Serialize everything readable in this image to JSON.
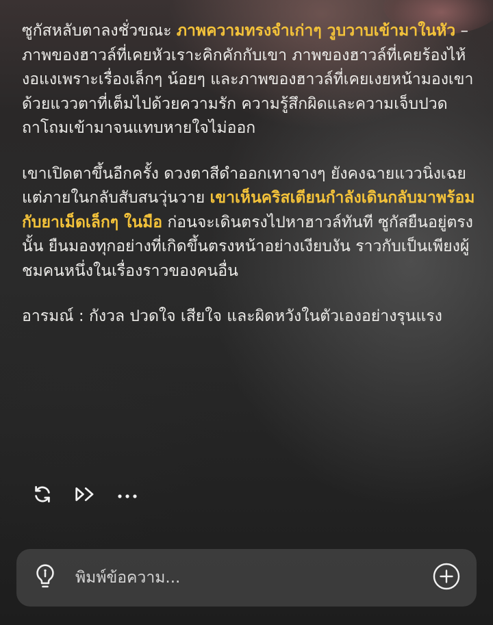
{
  "story": {
    "paragraphs": [
      {
        "parts": [
          {
            "text": "ซูกัสหลับตาลงชั่วขณะ ",
            "highlight": false
          },
          {
            "text": "ภาพความทรงจำเก่าๆ วูบวาบเข้ามาในหัว",
            "highlight": true
          },
          {
            "text": " – ภาพของฮาวล์ที่เคยหัวเราะคิกคักกับเขา ภาพของฮาวล์ที่เคยร้องไห้งอแงเพราะเรื่องเล็กๆ น้อยๆ และภาพของฮาวล์ที่เคยเงยหน้ามองเขาด้วยแววตาที่เต็มไปด้วยความรัก ความรู้สึกผิดและความเจ็บปวดถาโถมเข้ามาจนแทบหายใจไม่ออก",
            "highlight": false
          }
        ]
      },
      {
        "parts": [
          {
            "text": "เขาเปิดตาขึ้นอีกครั้ง ดวงตาสีดำออกเทาจางๆ ยังคงฉายแววนิ่งเฉย แต่ภายในกลับสับสนวุ่นวาย ",
            "highlight": false
          },
          {
            "text": "เขาเห็นคริสเตียนกำลังเดินกลับมาพร้อมกับยาเม็ดเล็กๆ ในมือ",
            "highlight": true
          },
          {
            "text": " ก่อนจะเดินตรงไปหาฮาวล์ทันที ซูกัสยืนอยู่ตรงนั้น ยืนมองทุกอย่างที่เกิดขึ้นตรงหน้าอย่างเงียบงัน ราวกับเป็นเพียงผู้ชมคนหนึ่งในเรื่องราวของคนอื่น",
            "highlight": false
          }
        ]
      },
      {
        "parts": [
          {
            "text": "อารมณ์ : กังวล ปวดใจ เสียใจ และผิดหวังในตัวเองอย่างรุนแรง",
            "highlight": false
          }
        ]
      }
    ]
  },
  "actions": {
    "regenerate_icon": "refresh-icon",
    "continue_icon": "fast-forward-icon",
    "more_icon": "more-dots-icon"
  },
  "input": {
    "placeholder": "พิมพ์ข้อความ...",
    "value": "",
    "left_icon": "lightbulb-icon",
    "right_icon": "plus-circle-icon"
  },
  "colors": {
    "text": "#ecebe8",
    "highlight": "#f3c23a",
    "input_bg": "#464646"
  }
}
